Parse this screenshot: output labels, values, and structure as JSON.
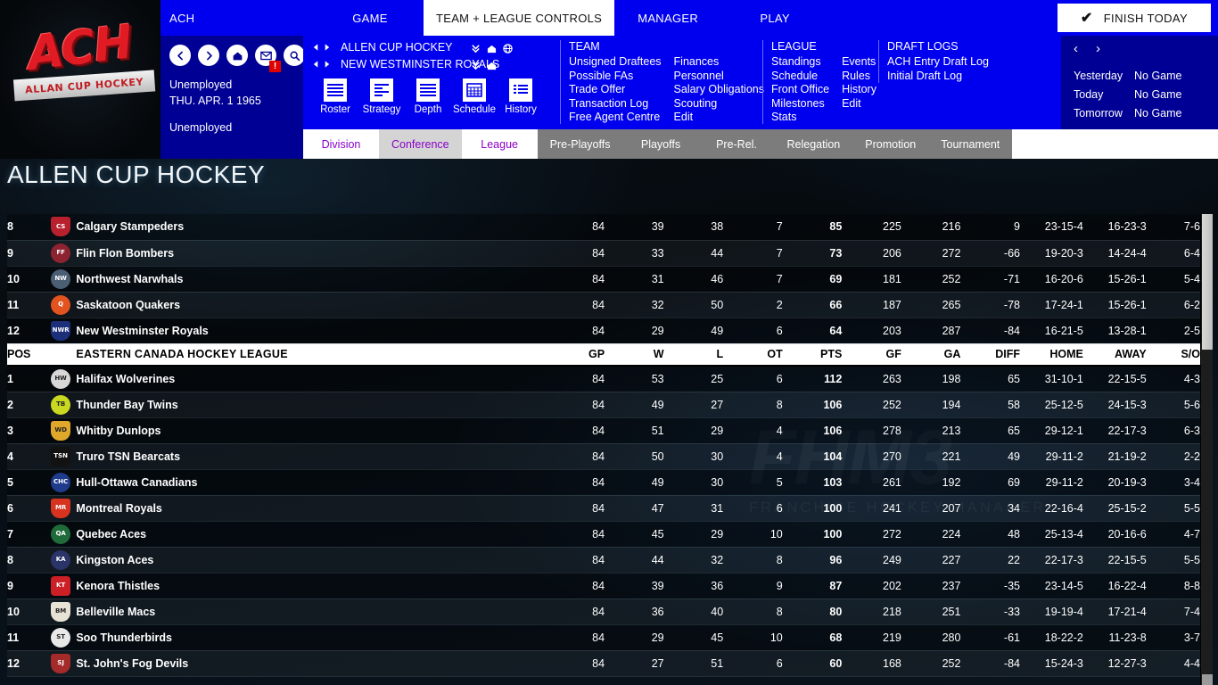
{
  "topbar": {
    "brand": "ACH",
    "items": [
      {
        "label": "GAME",
        "active": false
      },
      {
        "label": "TEAM + LEAGUE CONTROLS",
        "active": true
      },
      {
        "label": "MANAGER",
        "active": false
      },
      {
        "label": "PLAY",
        "active": false
      }
    ],
    "finish_button": "FINISH TODAY",
    "check_icon": "✔"
  },
  "logo": {
    "mark": "ACH",
    "ribbon": "ALLAN CUP HOCKEY"
  },
  "left_info": {
    "icons": [
      "back-icon",
      "forward-icon",
      "home-icon",
      "mail-icon",
      "search-icon"
    ],
    "mail_badge": "!",
    "line1": "Unemployed",
    "line2": "THU. APR. 1 1965",
    "line3": "Unemployed"
  },
  "nav_panel": {
    "selector_rows": [
      {
        "label": "ALLEN CUP HOCKEY",
        "icons": [
          "chevrons-down-icon",
          "home-icon",
          "globe-icon"
        ]
      },
      {
        "label": "NEW WESTMINSTER ROYALS",
        "icons": [
          "chevrons-down-icon",
          "home-icon"
        ]
      }
    ],
    "quick_buttons": [
      {
        "label": "Roster",
        "icon": "roster-icon"
      },
      {
        "label": "Strategy",
        "icon": "strategy-icon"
      },
      {
        "label": "Depth",
        "icon": "depth-icon"
      },
      {
        "label": "Schedule",
        "icon": "schedule-icon"
      },
      {
        "label": "History",
        "icon": "history-icon"
      }
    ],
    "team_section": {
      "heading": "TEAM",
      "col1": [
        "Unsigned Draftees",
        "Possible FAs",
        "Trade Offer",
        "Transaction Log",
        "Free Agent Centre"
      ],
      "col2": [
        "Finances",
        "Personnel",
        "Salary Obligations",
        "Scouting",
        "Edit"
      ]
    },
    "league_section": {
      "heading": "LEAGUE",
      "col1": [
        "Standings",
        "Schedule",
        "Front Office",
        "Milestones",
        "Stats"
      ],
      "col2": [
        "Events",
        "Rules",
        "History",
        "Edit"
      ]
    },
    "draft_section": {
      "heading": "DRAFT LOGS",
      "col1": [
        "ACH Entry Draft Log",
        "Initial Draft Log"
      ]
    }
  },
  "day_panel": {
    "prev": "‹",
    "next": "›",
    "rows": [
      {
        "day": "Yesterday",
        "status": "No Game"
      },
      {
        "day": "Today",
        "status": "No Game"
      },
      {
        "day": "Tomorrow",
        "status": "No Game"
      }
    ]
  },
  "sub_tabs": [
    {
      "label": "Division",
      "state": "sel-w"
    },
    {
      "label": "Conference",
      "state": "sel-g"
    },
    {
      "label": "League",
      "state": "sel-w"
    },
    {
      "label": "Pre-Playoffs",
      "state": "dim"
    },
    {
      "label": "Playoffs",
      "state": "dim"
    },
    {
      "label": "Pre-Rel.",
      "state": "dim"
    },
    {
      "label": "Relegation",
      "state": "dim"
    },
    {
      "label": "Promotion",
      "state": "dim"
    },
    {
      "label": "Tournament",
      "state": "dim"
    }
  ],
  "page_title": "ALLEN CUP HOCKEY",
  "watermark": {
    "main": "FHM3",
    "sub": "FRANCHISE HOCKEY MANAGER"
  },
  "table": {
    "columns": [
      "POS",
      "",
      "",
      "GP",
      "W",
      "L",
      "OT",
      "PTS",
      "GF",
      "GA",
      "DIFF",
      "HOME",
      "AWAY",
      "S/O"
    ],
    "top_rows": [
      {
        "pos": "8",
        "logo": "calgary-stampeders-logo",
        "lc": "#b8202e",
        "ls": "shield",
        "lt": "CS",
        "team": "Calgary Stampeders",
        "gp": "84",
        "w": "39",
        "l": "38",
        "ot": "7",
        "pts": "85",
        "gf": "225",
        "ga": "216",
        "diff": "9",
        "home": "23-15-4",
        "away": "16-23-3",
        "so": "7-6"
      },
      {
        "pos": "9",
        "logo": "flin-flon-bombers-logo",
        "lc": "#8d2230",
        "ls": "round",
        "lt": "FF",
        "team": "Flin Flon Bombers",
        "gp": "84",
        "w": "33",
        "l": "44",
        "ot": "7",
        "pts": "73",
        "gf": "206",
        "ga": "272",
        "diff": "-66",
        "home": "19-20-3",
        "away": "14-24-4",
        "so": "6-4"
      },
      {
        "pos": "10",
        "logo": "northwest-narwhals-logo",
        "lc": "#4a5e74",
        "ls": "round",
        "lt": "NW",
        "team": "Northwest Narwhals",
        "gp": "84",
        "w": "31",
        "l": "46",
        "ot": "7",
        "pts": "69",
        "gf": "181",
        "ga": "252",
        "diff": "-71",
        "home": "16-20-6",
        "away": "15-26-1",
        "so": "5-4"
      },
      {
        "pos": "11",
        "logo": "saskatoon-quakers-logo",
        "lc": "#e2531f",
        "ls": "round",
        "lt": "Q",
        "team": "Saskatoon Quakers",
        "gp": "84",
        "w": "32",
        "l": "50",
        "ot": "2",
        "pts": "66",
        "gf": "187",
        "ga": "265",
        "diff": "-78",
        "home": "17-24-1",
        "away": "15-26-1",
        "so": "6-2"
      },
      {
        "pos": "12",
        "logo": "new-westminster-royals-logo",
        "lc": "#1b2f7a",
        "ls": "shield",
        "lt": "NWR",
        "team": "New Westminster Royals",
        "gp": "84",
        "w": "29",
        "l": "49",
        "ot": "6",
        "pts": "64",
        "gf": "203",
        "ga": "287",
        "diff": "-84",
        "home": "16-21-5",
        "away": "13-28-1",
        "so": "2-5"
      }
    ],
    "section_header": {
      "pos": "POS",
      "title": "EASTERN CANADA HOCKEY LEAGUE"
    },
    "east_rows": [
      {
        "pos": "1",
        "logo": "halifax-wolverines-logo",
        "lc": "#d8d8d8",
        "ls": "round",
        "lt": "HW",
        "team": "Halifax Wolverines",
        "gp": "84",
        "w": "53",
        "l": "25",
        "ot": "6",
        "pts": "112",
        "gf": "263",
        "ga": "198",
        "diff": "65",
        "home": "31-10-1",
        "away": "22-15-5",
        "so": "4-3"
      },
      {
        "pos": "2",
        "logo": "thunder-bay-twins-logo",
        "lc": "#c9d820",
        "ls": "round",
        "lt": "TB",
        "team": "Thunder Bay Twins",
        "gp": "84",
        "w": "49",
        "l": "27",
        "ot": "8",
        "pts": "106",
        "gf": "252",
        "ga": "194",
        "diff": "58",
        "home": "25-12-5",
        "away": "24-15-3",
        "so": "5-6"
      },
      {
        "pos": "3",
        "logo": "whitby-dunlops-logo",
        "lc": "#e0a72a",
        "ls": "shield",
        "lt": "WD",
        "team": "Whitby Dunlops",
        "gp": "84",
        "w": "51",
        "l": "29",
        "ot": "4",
        "pts": "106",
        "gf": "278",
        "ga": "213",
        "diff": "65",
        "home": "29-12-1",
        "away": "22-17-3",
        "so": "6-3"
      },
      {
        "pos": "4",
        "logo": "truro-tsn-bearcats-logo",
        "lc": "#121212",
        "ls": "",
        "lt": "TSN",
        "team": "Truro TSN Bearcats",
        "gp": "84",
        "w": "50",
        "l": "30",
        "ot": "4",
        "pts": "104",
        "gf": "270",
        "ga": "221",
        "diff": "49",
        "home": "29-11-2",
        "away": "21-19-2",
        "so": "2-2"
      },
      {
        "pos": "5",
        "logo": "hull-ottawa-canadians-logo",
        "lc": "#1f3b8c",
        "ls": "round",
        "lt": "CHC",
        "team": "Hull-Ottawa Canadians",
        "gp": "84",
        "w": "49",
        "l": "30",
        "ot": "5",
        "pts": "103",
        "gf": "261",
        "ga": "192",
        "diff": "69",
        "home": "29-11-2",
        "away": "20-19-3",
        "so": "3-4"
      },
      {
        "pos": "6",
        "logo": "montreal-royals-logo",
        "lc": "#d8331f",
        "ls": "shield",
        "lt": "MR",
        "team": "Montreal Royals",
        "gp": "84",
        "w": "47",
        "l": "31",
        "ot": "6",
        "pts": "100",
        "gf": "241",
        "ga": "207",
        "diff": "34",
        "home": "22-16-4",
        "away": "25-15-2",
        "so": "5-5"
      },
      {
        "pos": "7",
        "logo": "quebec-aces-logo",
        "lc": "#1f6b3a",
        "ls": "round",
        "lt": "QA",
        "team": "Quebec Aces",
        "gp": "84",
        "w": "45",
        "l": "29",
        "ot": "10",
        "pts": "100",
        "gf": "272",
        "ga": "224",
        "diff": "48",
        "home": "25-13-4",
        "away": "20-16-6",
        "so": "4-7"
      },
      {
        "pos": "8",
        "logo": "kingston-aces-logo",
        "lc": "#2a3468",
        "ls": "round",
        "lt": "KA",
        "team": "Kingston Aces",
        "gp": "84",
        "w": "44",
        "l": "32",
        "ot": "8",
        "pts": "96",
        "gf": "249",
        "ga": "227",
        "diff": "22",
        "home": "22-17-3",
        "away": "22-15-5",
        "so": "5-5"
      },
      {
        "pos": "9",
        "logo": "kenora-thistles-logo",
        "lc": "#cc1f26",
        "ls": "",
        "lt": "KT",
        "team": "Kenora Thistles",
        "gp": "84",
        "w": "39",
        "l": "36",
        "ot": "9",
        "pts": "87",
        "gf": "202",
        "ga": "237",
        "diff": "-35",
        "home": "23-14-5",
        "away": "16-22-4",
        "so": "8-8"
      },
      {
        "pos": "10",
        "logo": "belleville-macs-logo",
        "lc": "#e7e2d6",
        "ls": "shield",
        "lt": "BM",
        "team": "Belleville Macs",
        "gp": "84",
        "w": "36",
        "l": "40",
        "ot": "8",
        "pts": "80",
        "gf": "218",
        "ga": "251",
        "diff": "-33",
        "home": "19-19-4",
        "away": "17-21-4",
        "so": "7-4"
      },
      {
        "pos": "11",
        "logo": "soo-thunderbirds-logo",
        "lc": "#e8e8e8",
        "ls": "round",
        "lt": "ST",
        "team": "Soo Thunderbirds",
        "gp": "84",
        "w": "29",
        "l": "45",
        "ot": "10",
        "pts": "68",
        "gf": "219",
        "ga": "280",
        "diff": "-61",
        "home": "18-22-2",
        "away": "11-23-8",
        "so": "3-7"
      },
      {
        "pos": "12",
        "logo": "st-johns-fog-devils-logo",
        "lc": "#a52a2a",
        "ls": "shield",
        "lt": "SJ",
        "team": "St. John's Fog Devils",
        "gp": "84",
        "w": "27",
        "l": "51",
        "ot": "6",
        "pts": "60",
        "gf": "168",
        "ga": "252",
        "diff": "-84",
        "home": "15-24-3",
        "away": "12-27-3",
        "so": "4-4"
      }
    ]
  }
}
